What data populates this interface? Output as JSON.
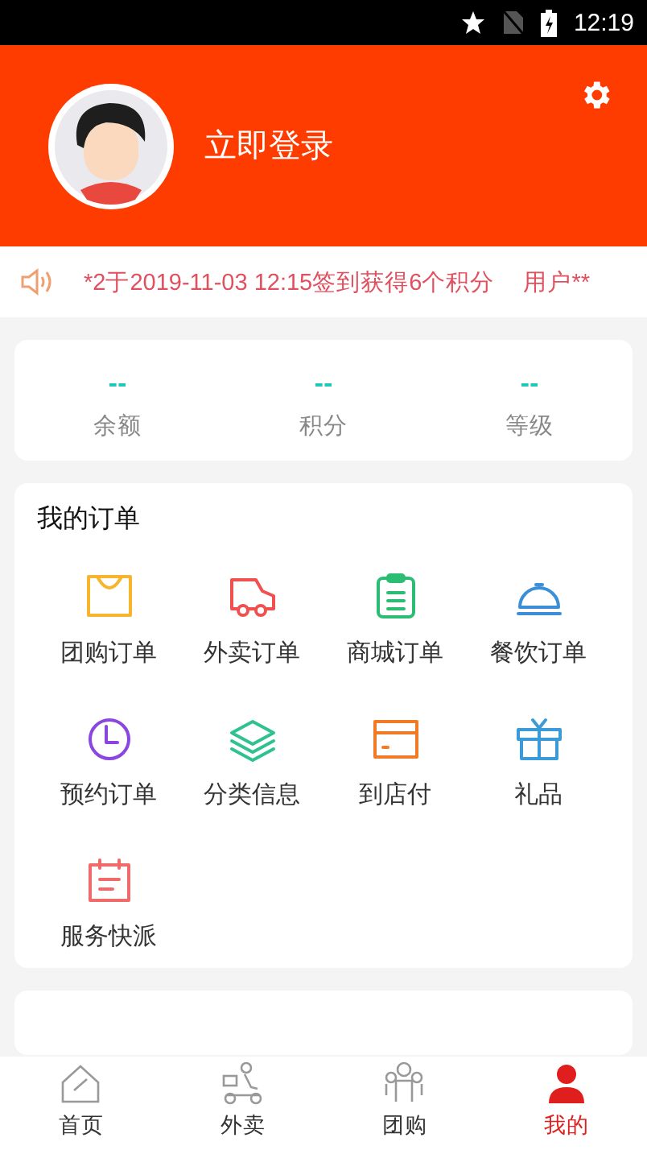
{
  "status_bar": {
    "time": "12:19"
  },
  "header": {
    "login": "立即登录"
  },
  "notice": {
    "texts": [
      "*2于2019-11-03 12:15签到获得6个积分",
      "用户**"
    ]
  },
  "stats": [
    {
      "value": "--",
      "label": "余额"
    },
    {
      "value": "--",
      "label": "积分"
    },
    {
      "value": "--",
      "label": "等级"
    }
  ],
  "orders": {
    "title": "我的订单",
    "items": [
      {
        "label": "团购订单"
      },
      {
        "label": "外卖订单"
      },
      {
        "label": "商城订单"
      },
      {
        "label": "餐饮订单"
      },
      {
        "label": "预约订单"
      },
      {
        "label": "分类信息"
      },
      {
        "label": "到店付"
      },
      {
        "label": "礼品"
      },
      {
        "label": "服务快派"
      }
    ]
  },
  "bottom_nav": [
    {
      "label": "首页",
      "selected": false
    },
    {
      "label": "外卖",
      "selected": false
    },
    {
      "label": "团购",
      "selected": false
    },
    {
      "label": "我的",
      "selected": true
    }
  ]
}
